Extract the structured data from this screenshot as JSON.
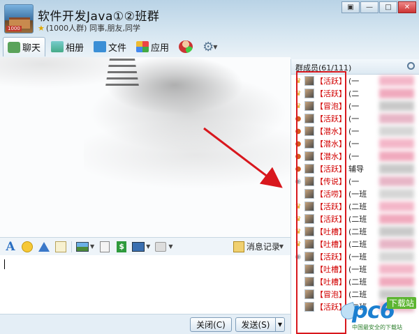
{
  "window": {
    "title": "软件开发Java①②班群",
    "subtitle": "(1000人群) 同事,朋友,同学",
    "logo_text": "1000",
    "controls": [
      {
        "name": "restore-icon",
        "glyph": "▣"
      },
      {
        "name": "minimize-icon",
        "glyph": "—"
      },
      {
        "name": "maximize-icon",
        "glyph": "□"
      },
      {
        "name": "close-icon",
        "glyph": "✕"
      }
    ]
  },
  "tabs": [
    {
      "label": "聊天",
      "icon": "chat-icon",
      "active": true
    },
    {
      "label": "相册",
      "icon": "album-icon",
      "active": false
    },
    {
      "label": "文件",
      "icon": "folder-icon",
      "active": false
    },
    {
      "label": "应用",
      "icon": "apps-icon",
      "active": false
    }
  ],
  "input_toolbar": {
    "font_glyph": "A",
    "history_label": "消息记录",
    "dollar_glyph": "$"
  },
  "buttons": {
    "close": "关闭(C)",
    "send": "发送(S)",
    "dropdown": "▼"
  },
  "members": {
    "header": "群成员(61/111)",
    "list": [
      {
        "badge": "crown",
        "tag": "【活跃】",
        "name": "(一"
      },
      {
        "badge": "crown",
        "tag": "【活跃】",
        "name": "(二"
      },
      {
        "badge": "crown",
        "tag": "【冒泡】",
        "name": "(一"
      },
      {
        "badge": "person",
        "tag": "【活跃】",
        "name": "(一"
      },
      {
        "badge": "person",
        "tag": "【潜水】",
        "name": "(一"
      },
      {
        "badge": "person",
        "tag": "【潜水】",
        "name": "(一"
      },
      {
        "badge": "person",
        "tag": "【潜水】",
        "name": "(一"
      },
      {
        "badge": "person",
        "tag": "【活跃】",
        "name": "辅导"
      },
      {
        "badge": "gray",
        "tag": "【传说】",
        "name": "(一"
      },
      {
        "badge": "none",
        "tag": "【活唠】",
        "name": "(一班"
      },
      {
        "badge": "crown",
        "tag": "【活跃】",
        "name": "(二班"
      },
      {
        "badge": "crown",
        "tag": "【活跃】",
        "name": "(二班"
      },
      {
        "badge": "crown",
        "tag": "【吐槽】",
        "name": "(二班"
      },
      {
        "badge": "crown",
        "tag": "【吐槽】",
        "name": "(二班"
      },
      {
        "badge": "gray",
        "tag": "【活跃】",
        "name": "(一班"
      },
      {
        "badge": "none",
        "tag": "【吐槽】",
        "name": "(一班"
      },
      {
        "badge": "none",
        "tag": "【吐槽】",
        "name": "(二班"
      },
      {
        "badge": "none",
        "tag": "【冒泡】",
        "name": "(二班"
      },
      {
        "badge": "none",
        "tag": "【活跃】",
        "name": "(二班"
      }
    ]
  },
  "watermark": {
    "text": "pc6",
    "badge": "下载站",
    "sub": "中国最安全的下载站"
  },
  "colors": {
    "highlight": "#d8171d",
    "tag_red": "#d20000",
    "window_bg": "#e9f1f7"
  }
}
